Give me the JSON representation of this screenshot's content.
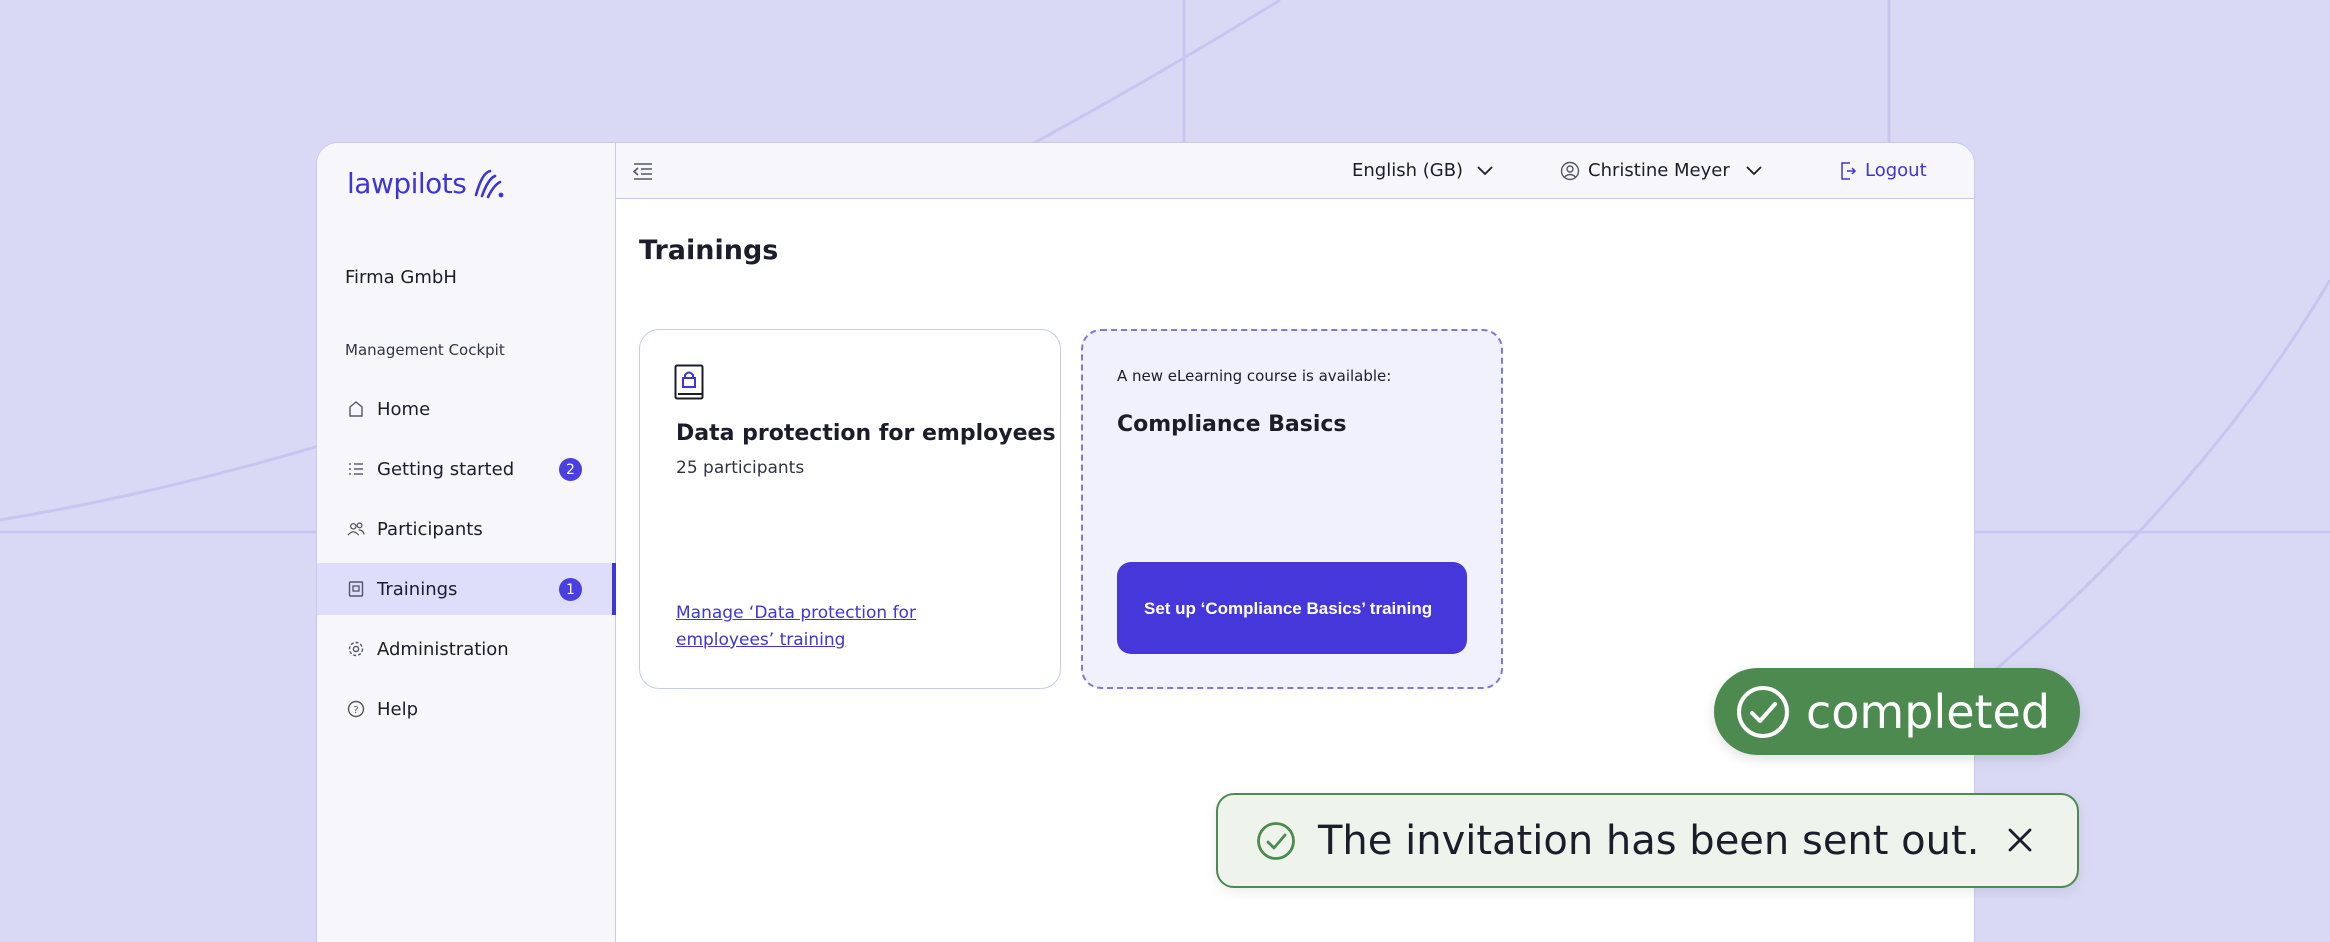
{
  "brand": {
    "name": "lawpilots",
    "accent": "#3d35d6",
    "success": "#4d8a4f"
  },
  "sidebar": {
    "company": "Firma GmbH",
    "section": "Management Cockpit",
    "items": [
      {
        "label": "Home",
        "icon": "home-icon"
      },
      {
        "label": "Getting started",
        "icon": "list-icon",
        "badge": "2"
      },
      {
        "label": "Participants",
        "icon": "users-icon"
      },
      {
        "label": "Trainings",
        "icon": "training-icon",
        "badge": "1",
        "active": true
      },
      {
        "label": "Administration",
        "icon": "gear-icon"
      },
      {
        "label": "Help",
        "icon": "help-icon"
      }
    ]
  },
  "topbar": {
    "language": "English (GB)",
    "user": "Christine Meyer",
    "logout": "Logout"
  },
  "main": {
    "title": "Trainings",
    "card1": {
      "title": "Data protection for employees",
      "participants": "25 participants",
      "link": "Manage ‘Data protection for employees’ training"
    },
    "card2": {
      "label": "A new eLearning course is available:",
      "title": "Compliance Basics",
      "button": "Set up ‘Compliance Basics’ training"
    }
  },
  "status": {
    "completed": "completed"
  },
  "toast": {
    "message": "The invitation has been sent out."
  }
}
